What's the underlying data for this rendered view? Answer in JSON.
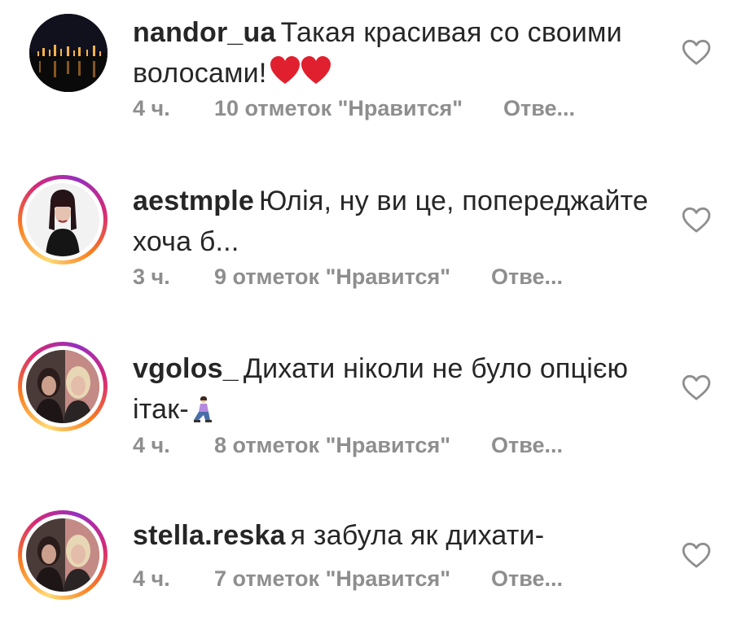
{
  "comments": [
    {
      "username": "nandor_ua",
      "text": "Такая красивая со своими волосами!",
      "emoji": "❤️❤️",
      "time": "4 ч.",
      "likes": "10 отметок \"Нравится\"",
      "reply": "Отве...",
      "avatar": "city-night-photo"
    },
    {
      "username": "aestmple",
      "text": "Юлія, ну ви це, попереджайте хоча б...",
      "emoji": "",
      "time": "3 ч.",
      "likes": "9 отметок \"Нравится\"",
      "reply": "Отве...",
      "avatar": "woman-portrait-photo"
    },
    {
      "username": "vgolos_",
      "text": "Дихати ніколи не було опцією ітак-",
      "emoji": "🧎‍♀️",
      "time": "4 ч.",
      "likes": "8 отметок \"Нравится\"",
      "reply": "Отве...",
      "avatar": "two-girls-selfie-photo"
    },
    {
      "username": "stella.reska",
      "text": "я забула як дихати-",
      "emoji": "",
      "time": "4 ч.",
      "likes": "7 отметок \"Нравится\"",
      "reply": "Отве...",
      "avatar": "two-girls-selfie-photo"
    }
  ],
  "colors": {
    "text": "#262626",
    "meta": "#8e8e8e",
    "heart_emoji": "#e0202e",
    "story_ring_start": "#feda75",
    "story_ring_end": "#d62976"
  },
  "icons": {
    "like": "heart-outline-icon"
  }
}
